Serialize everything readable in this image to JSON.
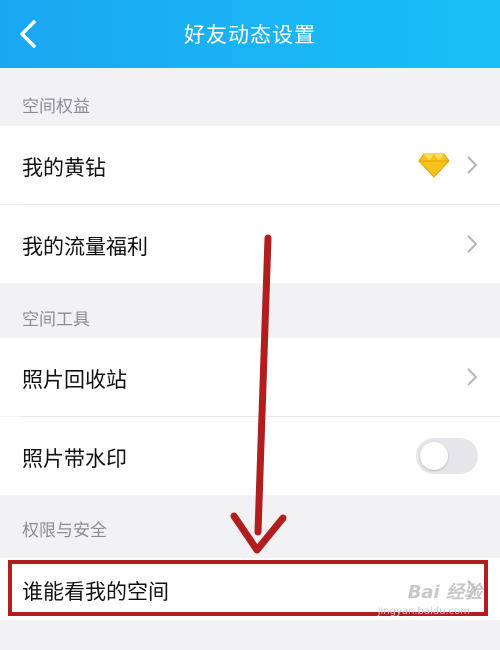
{
  "header": {
    "title": "好友动态设置",
    "back_icon": "chevron-left-icon"
  },
  "sections": {
    "benefits": {
      "label": "空间权益",
      "items": [
        {
          "label": "我的黄钻",
          "accessory": "diamond-icon"
        },
        {
          "label": "我的流量福利"
        }
      ]
    },
    "tools": {
      "label": "空间工具",
      "items": [
        {
          "label": "照片回收站"
        },
        {
          "label": "照片带水印",
          "toggle_on": false
        }
      ]
    },
    "privacy": {
      "label": "权限与安全",
      "items": [
        {
          "label": "谁能看我的空间"
        }
      ]
    }
  },
  "watermark": {
    "text": "Bai 经验",
    "sub": "jingyan.baidu.com"
  },
  "colors": {
    "header": "#1aa7f2",
    "annotation": "#b21d1d",
    "section_text": "#8c8c94"
  }
}
